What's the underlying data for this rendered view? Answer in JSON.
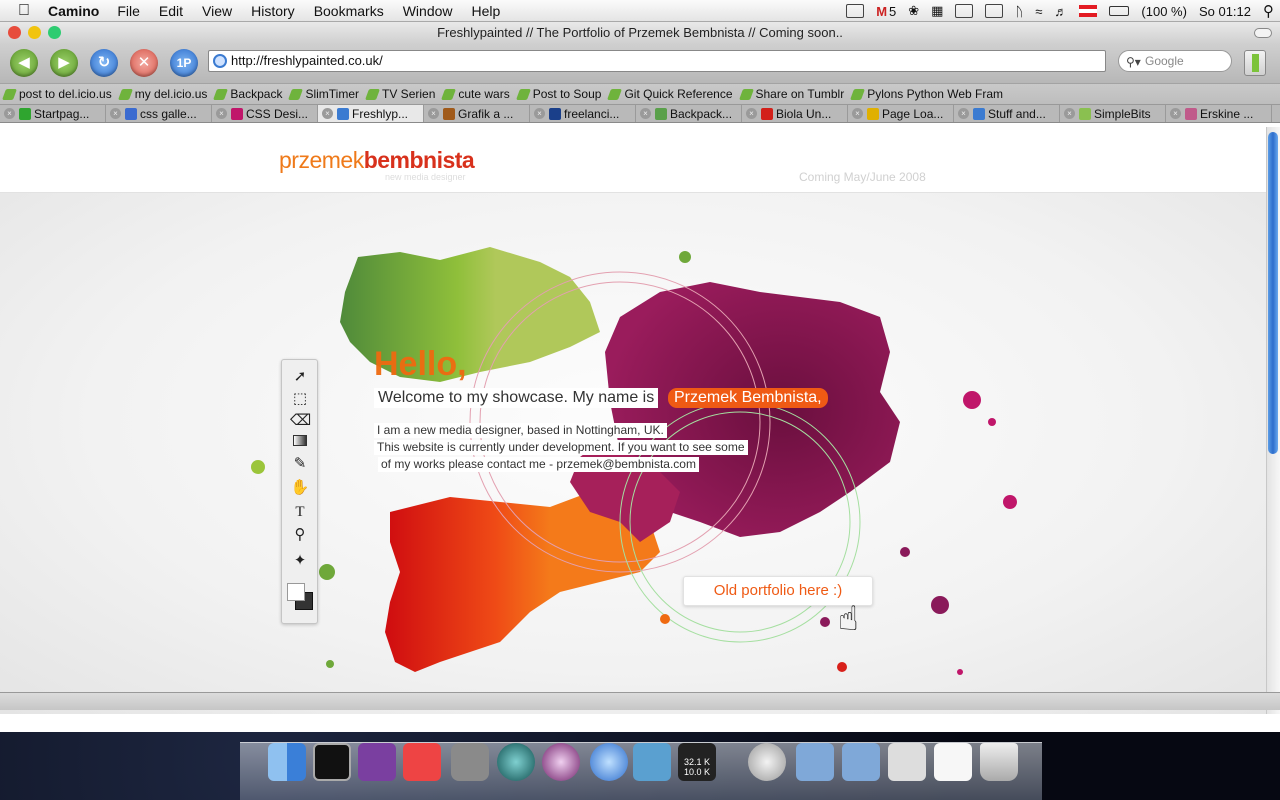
{
  "menubar": {
    "app": "Camino",
    "items": [
      "File",
      "Edit",
      "View",
      "History",
      "Bookmarks",
      "Window",
      "Help"
    ],
    "mail_count": "5",
    "battery": "(100 %)",
    "clock": "So 01:12"
  },
  "window": {
    "title": "Freshlypainted // The Portfolio of Przemek Bembnista // Coming soon..",
    "url": "http://freshlypainted.co.uk/",
    "search_placeholder": "Google",
    "onepassword": "1P"
  },
  "bookmarks": [
    "post to del.icio.us",
    "my del.icio.us",
    "Backpack",
    "SlimTimer",
    "TV Serien",
    "cute wars",
    "Post to Soup",
    "Git Quick Reference",
    "Share on Tumblr",
    "Pylons Python Web Fram"
  ],
  "tabs": [
    {
      "label": "Startpag...",
      "color": "#2fa52f"
    },
    {
      "label": "css galle...",
      "color": "#3b6bd0"
    },
    {
      "label": "CSS Desi...",
      "color": "#c0166a"
    },
    {
      "label": "Freshlyp...",
      "color": "#3b7bd1",
      "active": true
    },
    {
      "label": "Grafik a ...",
      "color": "#a05a1a"
    },
    {
      "label": "freelanci...",
      "color": "#1a3f8a"
    },
    {
      "label": "Backpack...",
      "color": "#5aa04a"
    },
    {
      "label": "Biola Un...",
      "color": "#d2201a"
    },
    {
      "label": "Page Loa...",
      "color": "#e0b000"
    },
    {
      "label": "Stuff and...",
      "color": "#3b7bd1"
    },
    {
      "label": "SimpleBits",
      "color": "#8ac050"
    },
    {
      "label": "Erskine ...",
      "color": "#c05a8a"
    }
  ],
  "site": {
    "logo_light": "przemek",
    "logo_bold": "bembnista",
    "logo_sub": "new media designer",
    "coming": "Coming May/June 2008",
    "hello": "Hello,",
    "welcome": "Welcome to my showcase. My name is",
    "name": "Przemek Bembnista,",
    "line1": "I am a new media designer, based in Nottingham, UK.",
    "line2": "This website is currently under development. If you want to see some",
    "line3": "of my works please contact me - przemek@bembnista.com",
    "old_portfolio": "Old portfolio here :)"
  },
  "dock": {
    "net_up": "32.1 K",
    "net_down": "10.0 K"
  },
  "colors": {
    "accent": "#ef5a14",
    "green": "#6fa83a",
    "magenta": "#8a1a5a",
    "red": "#d8201a"
  }
}
